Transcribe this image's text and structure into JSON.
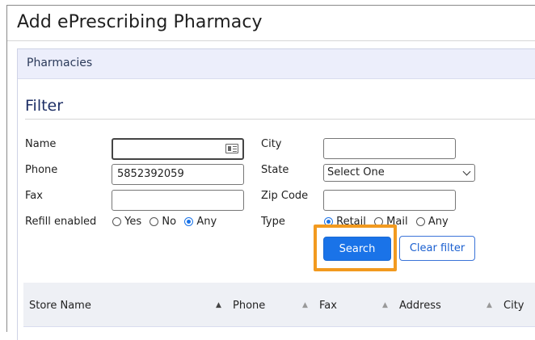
{
  "window": {
    "title": "Add ePrescribing Pharmacy"
  },
  "panel": {
    "header": "Pharmacies"
  },
  "filter": {
    "title": "Filter",
    "name": {
      "label": "Name",
      "value": ""
    },
    "phone": {
      "label": "Phone",
      "value": "5852392059"
    },
    "fax": {
      "label": "Fax",
      "value": ""
    },
    "refill": {
      "label": "Refill enabled",
      "options": [
        "Yes",
        "No",
        "Any"
      ],
      "selected": "Any"
    },
    "city": {
      "label": "City",
      "value": ""
    },
    "state": {
      "label": "State",
      "selected": "Select One"
    },
    "zip": {
      "label": "Zip Code",
      "value": ""
    },
    "type": {
      "label": "Type",
      "options": [
        "Retail",
        "Mail",
        "Any"
      ],
      "selected": "Retail"
    },
    "buttons": {
      "search": "Search",
      "clear": "Clear filter"
    }
  },
  "table": {
    "columns": [
      "Store Name",
      "Phone",
      "Fax",
      "Address",
      "City"
    ]
  },
  "colors": {
    "accent": "#1a73e8",
    "highlight": "#f29a1f",
    "header_bg": "#eceefb"
  },
  "icons": {
    "name_field": "contact-card-icon",
    "sort": "sort-arrow-icon",
    "select": "chevron-down-icon"
  }
}
